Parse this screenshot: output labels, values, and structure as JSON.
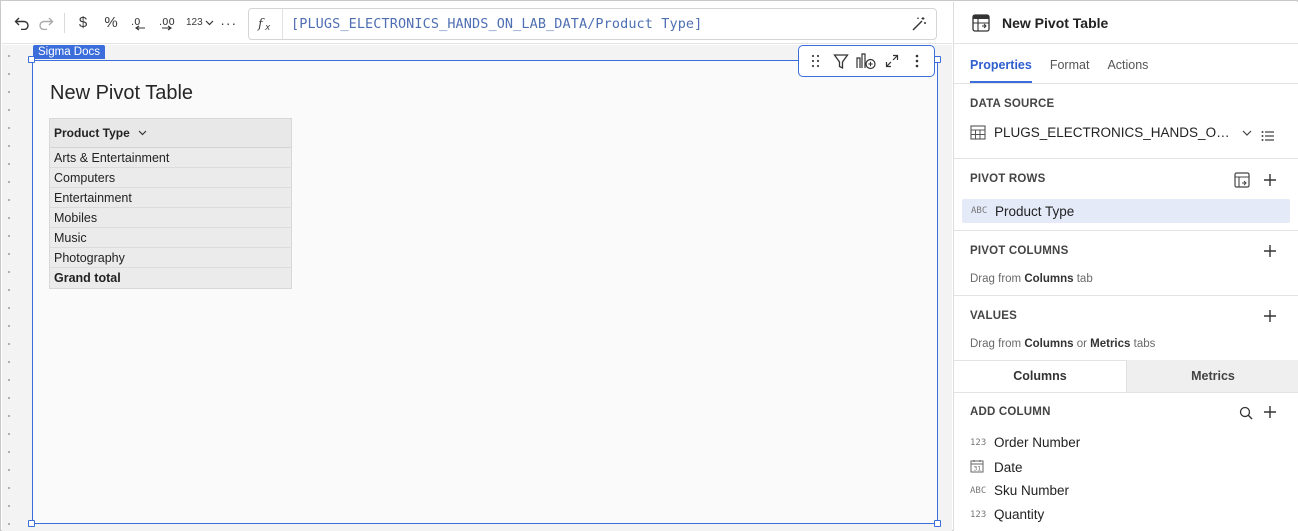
{
  "toolbar": {
    "format_number_label": "123",
    "formula": "[PLUGS_ELECTRONICS_HANDS_ON_LAB_DATA/Product Type]",
    "fx_label": "fx"
  },
  "canvas": {
    "doc_tag": "Sigma Docs",
    "pivot_title": "New Pivot Table",
    "pivot": {
      "header": "Product Type",
      "rows": [
        "Arts & Entertainment",
        "Computers",
        "Entertainment",
        "Mobiles",
        "Music",
        "Photography"
      ],
      "total": "Grand total"
    }
  },
  "panel": {
    "title": "New Pivot Table",
    "tabs": [
      "Properties",
      "Format",
      "Actions"
    ],
    "data_source": {
      "label": "DATA SOURCE",
      "value": "PLUGS_ELECTRONICS_HANDS_ON_LAB_DATA"
    },
    "pivot_rows": {
      "label": "PIVOT ROWS",
      "field_type": "ABC",
      "field": "Product Type"
    },
    "pivot_columns": {
      "label": "PIVOT COLUMNS",
      "hint_pre": "Drag from ",
      "hint_b1": "Columns",
      "hint_post": " tab"
    },
    "values": {
      "label": "VALUES",
      "hint_pre": "Drag from ",
      "hint_b1": "Columns",
      "hint_mid": " or ",
      "hint_b2": "Metrics",
      "hint_post": " tabs"
    },
    "sub_tabs": [
      "Columns",
      "Metrics"
    ],
    "add_column": {
      "label": "ADD COLUMN",
      "columns": [
        {
          "type": "123",
          "name": "Order Number"
        },
        {
          "type": "date",
          "name": "Date"
        },
        {
          "type": "ABC",
          "name": "Sku Number"
        },
        {
          "type": "123",
          "name": "Quantity"
        }
      ]
    }
  },
  "colors": {
    "accent": "#3b6ddb",
    "formula_text": "#4f6fb3",
    "pill": "#e4eaf8"
  }
}
